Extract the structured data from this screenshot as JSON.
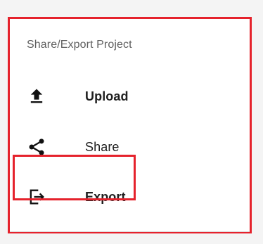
{
  "menu": {
    "title": "Share/Export Project",
    "items": [
      {
        "label": "Upload",
        "icon": "upload-icon"
      },
      {
        "label": "Share",
        "icon": "share-icon"
      },
      {
        "label": "Export",
        "icon": "export-icon"
      }
    ]
  },
  "colors": {
    "highlight": "#e5222c",
    "text": "#202020",
    "title": "#5f5f5f"
  }
}
